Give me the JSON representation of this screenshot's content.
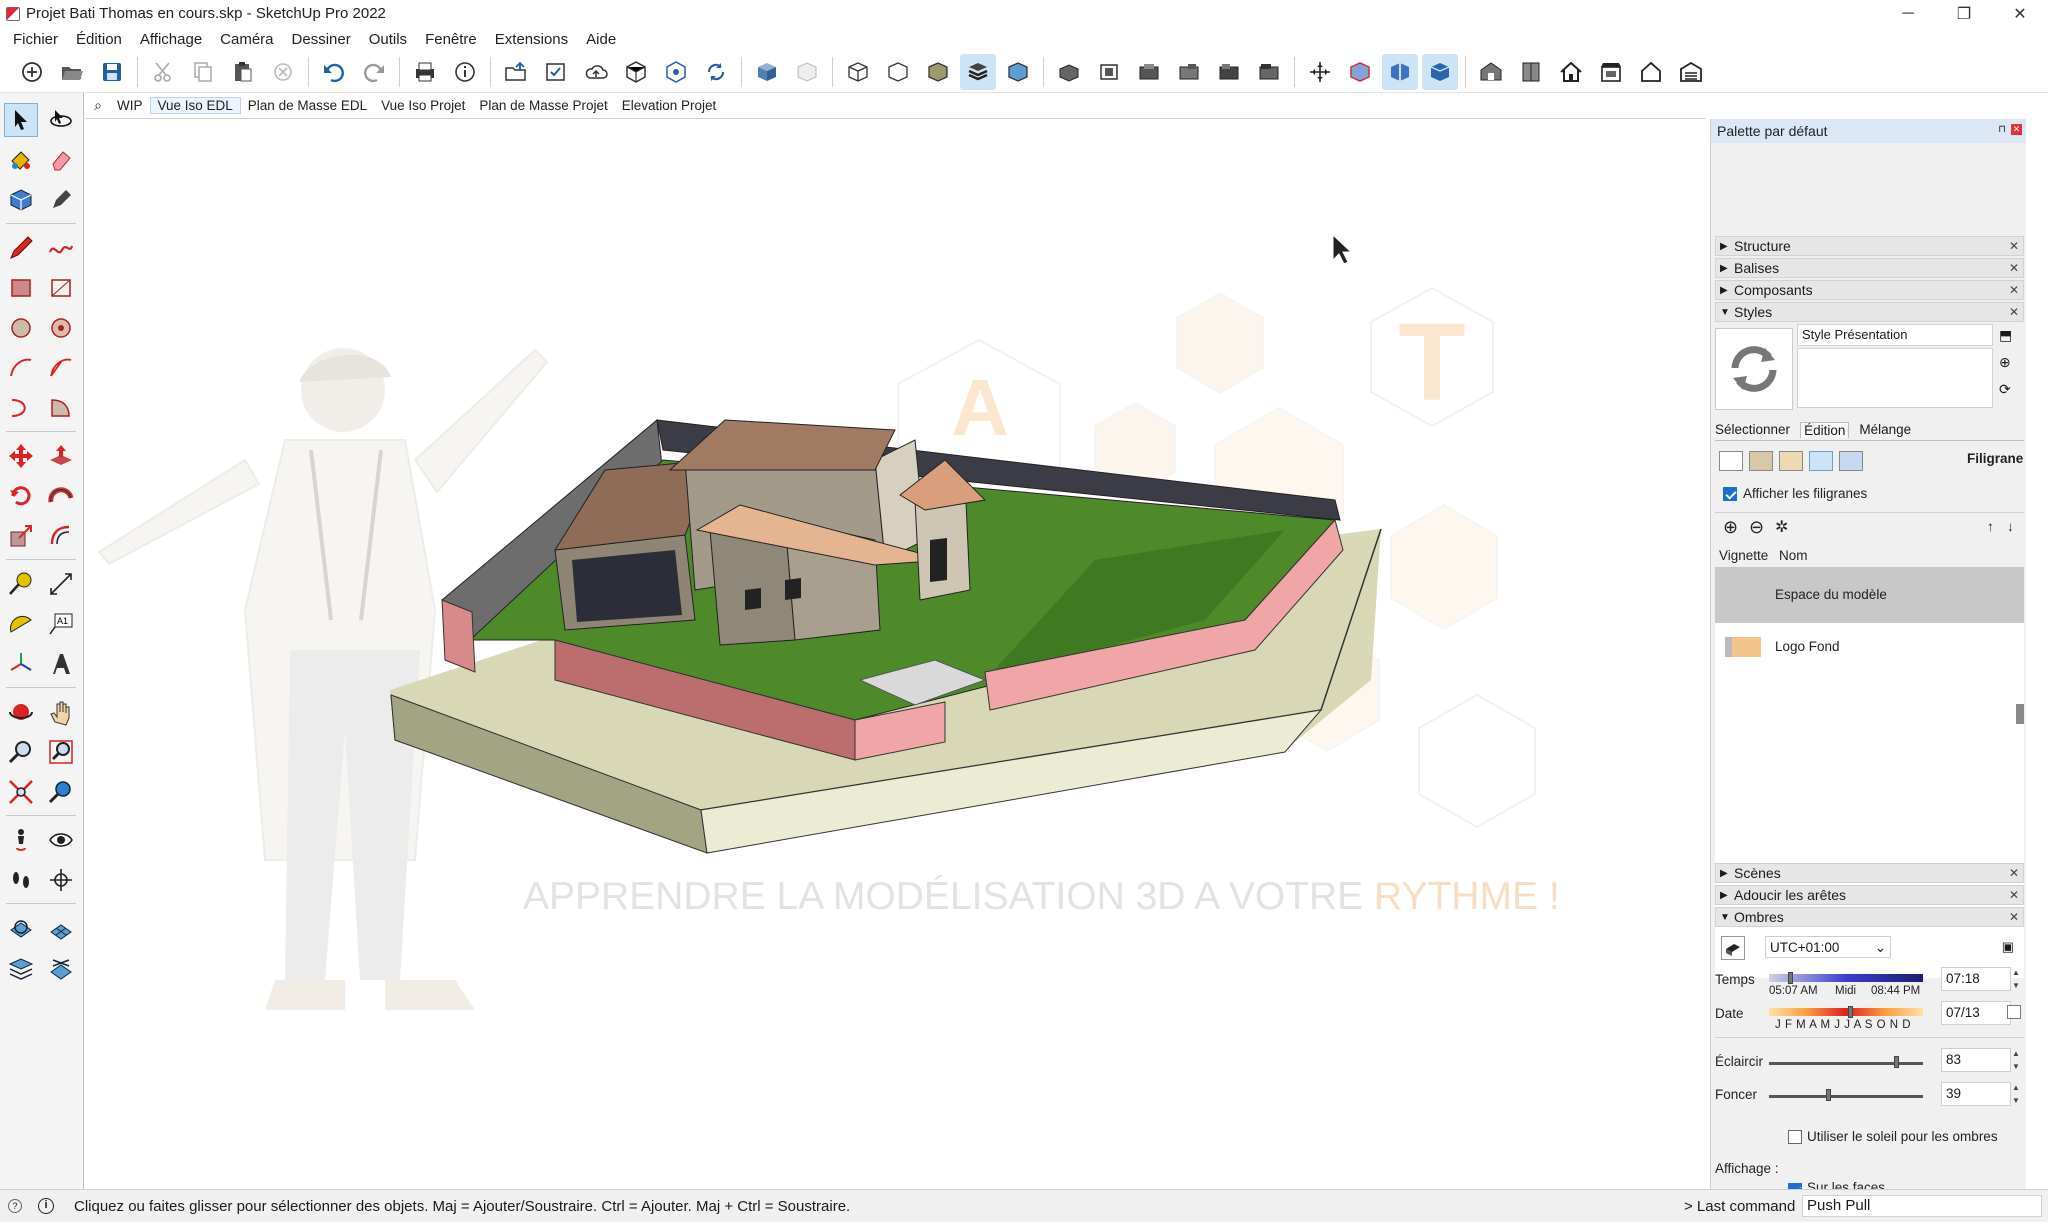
{
  "window": {
    "title": "Projet Bati Thomas en cours.skp - SketchUp Pro 2022",
    "min": "─",
    "max": "❐",
    "close": "✕"
  },
  "menu": [
    "Fichier",
    "Édition",
    "Affichage",
    "Caméra",
    "Dessiner",
    "Outils",
    "Fenêtre",
    "Extensions",
    "Aide"
  ],
  "scenes": {
    "active_index": 1,
    "tabs": [
      "WIP",
      "Vue Iso EDL",
      "Plan de Masse EDL",
      "Vue Iso Projet",
      "Plan de Masse Projet",
      "Elevation Projet"
    ]
  },
  "watermark": {
    "line_a": "APPRENDRE LA MODÉLISATION 3D A VOTRE ",
    "line_b": "RYTHME",
    "line_c": " !",
    "hex_letters": [
      "A",
      "T"
    ]
  },
  "tray": {
    "title": "Palette par défaut",
    "panels_top": [
      {
        "label": "Structure",
        "open": "▶"
      },
      {
        "label": "Balises",
        "open": "▶"
      },
      {
        "label": "Composants",
        "open": "▶"
      },
      {
        "label": "Styles",
        "open": "▼"
      }
    ],
    "styles": {
      "name": "Style Présentation",
      "tabs": [
        "Sélectionner",
        "Édition",
        "Mélange"
      ],
      "active_tab": "Édition",
      "section": "Filigrane",
      "show_watermarks": "Afficher les filigranes",
      "col_vignette": "Vignette",
      "col_nom": "Nom",
      "row_space": "Espace du modèle",
      "row_logo": "Logo Fond"
    },
    "panels_bottom": [
      {
        "label": "Scènes",
        "open": "▶"
      },
      {
        "label": "Adoucir les arêtes",
        "open": "▶"
      },
      {
        "label": "Ombres",
        "open": "▼"
      }
    ],
    "shadows": {
      "timezone": "UTC+01:00",
      "time_label": "Temps",
      "time_start": "05:07 AM",
      "time_mid": "Midi",
      "time_end": "08:44 PM",
      "time_value": "07:18",
      "date_label": "Date",
      "months": "J F M A M J J A S O N D",
      "date_value": "07/13",
      "light_label": "Éclaircir",
      "light_value": "83",
      "light_level": 0.83,
      "dark_label": "Foncer",
      "dark_value": "39",
      "dark_level": 0.39,
      "use_sun": "Utiliser le soleil pour les ombres",
      "display_label": "Affichage :",
      "on_faces": "Sur les faces"
    }
  },
  "status": {
    "message": "Cliquez ou faites glisser pour sélectionner des objets. Maj = Ajouter/Soustraire. Ctrl = Ajouter. Maj + Ctrl = Soustraire.",
    "last_command_label": "> Last command",
    "last_command_value": "Push Pull"
  },
  "colors": {
    "accent": "#1a6fd0",
    "grass": "#4e8a2a",
    "wall_pink": "#e89a9a",
    "roof": "#a07a62",
    "orange_hex": "#f3c48c"
  }
}
